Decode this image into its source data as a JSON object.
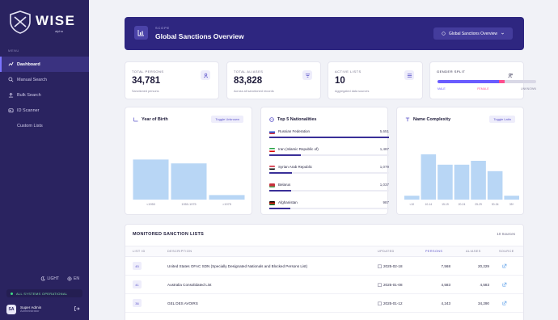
{
  "app": {
    "logo_text": "WISE",
    "logo_subtitle": "alpha",
    "nav_section": "MENU",
    "nav": [
      {
        "label": "Dashboard",
        "icon": "dashboard-icon",
        "active": true
      },
      {
        "label": "Manual Search",
        "icon": "search-icon",
        "active": false
      },
      {
        "label": "Bulk Search",
        "icon": "upload-icon",
        "active": false
      },
      {
        "label": "ID Scanner",
        "icon": "scan-icon",
        "active": false
      },
      {
        "label": "Custom Lists",
        "icon": "",
        "active": false
      }
    ],
    "theme_label": "LIGHT",
    "language_label": "EN",
    "status_text": "ALL SYSTEMS OPERATIONAL",
    "user": {
      "initials": "SA",
      "name": "Super Admin",
      "role": "Administrator"
    }
  },
  "banner": {
    "kicker": "SCOPE",
    "title": "Global Sanctions Overview",
    "select_value": "Global Sanctions Overview"
  },
  "stats": {
    "total_persons": {
      "label": "TOTAL PERSONS",
      "value": "34,781",
      "sub": "Sanctioned persons"
    },
    "total_aliases": {
      "label": "TOTAL ALIASES",
      "value": "83,828",
      "sub": "Across all sanctioned records"
    },
    "active_lists": {
      "label": "ACTIVE LISTS",
      "value": "10",
      "sub": "Aggregated data sources"
    },
    "gender_split": {
      "label": "GENDER SPLIT",
      "male_label": "MALE",
      "female_label": "FEMALE",
      "unknown_label": "UNKNOWN",
      "male": 0.62,
      "female": 0.06,
      "unknown": 0.32
    }
  },
  "colors": {
    "accent": "#2e2680",
    "male": "#6a5cff",
    "female": "#ff4d8d",
    "unknown": "#d9d8e6",
    "bar": "#b8d6f5",
    "bar_dark": "#3a2f98"
  },
  "cards": {
    "year_of_birth": {
      "title": "Year of Birth",
      "button": "Toggle Unknown"
    },
    "nationalities": {
      "title": "Top 5 Nationalities"
    },
    "name_complexity": {
      "title": "Name Complexity",
      "button": "Toggle Latin"
    }
  },
  "chart_data": [
    {
      "type": "bar",
      "title": "Year of Birth",
      "categories": [
        "<1950",
        "1950-1975",
        ">1975"
      ],
      "values": [
        0.62,
        0.56,
        0.07
      ]
    },
    {
      "type": "bar",
      "title": "Top 5 Nationalities",
      "categories": [
        "Russian Federation",
        "Iran (Islamic Republic of)",
        "Syrian Arab Republic",
        "Belarus",
        "Afghanistan"
      ],
      "values": [
        5651,
        1487,
        1079,
        1037,
        987
      ]
    },
    {
      "type": "bar",
      "title": "Name Complexity",
      "categories": [
        "<10",
        "10-14",
        "15-19",
        "20-24",
        "25-29",
        "30-34",
        "35+"
      ],
      "values": [
        0.06,
        0.7,
        0.54,
        0.54,
        0.6,
        0.44,
        0.06
      ]
    }
  ],
  "table": {
    "title": "MONITORED SANCTION LISTS",
    "count": "10 Sources",
    "headers": [
      "LIST ID",
      "DESCRIPTION",
      "UPDATED",
      "PERSONS",
      "ALIASES",
      "SOURCE"
    ],
    "rows": [
      {
        "id": "45",
        "description": "United States OFAC SDN (Specially Designated Nationals and Blocked Persons List)",
        "updated": "2025-02-18",
        "persons": "7,568",
        "aliases": "20,229"
      },
      {
        "id": "41",
        "description": "Australia Consolidated List",
        "updated": "2025-01-08",
        "persons": "4,583",
        "aliases": "4,583"
      },
      {
        "id": "36",
        "description": "GEL DES AVOIRS",
        "updated": "2025-01-12",
        "persons": "4,243",
        "aliases": "34,290"
      }
    ]
  }
}
